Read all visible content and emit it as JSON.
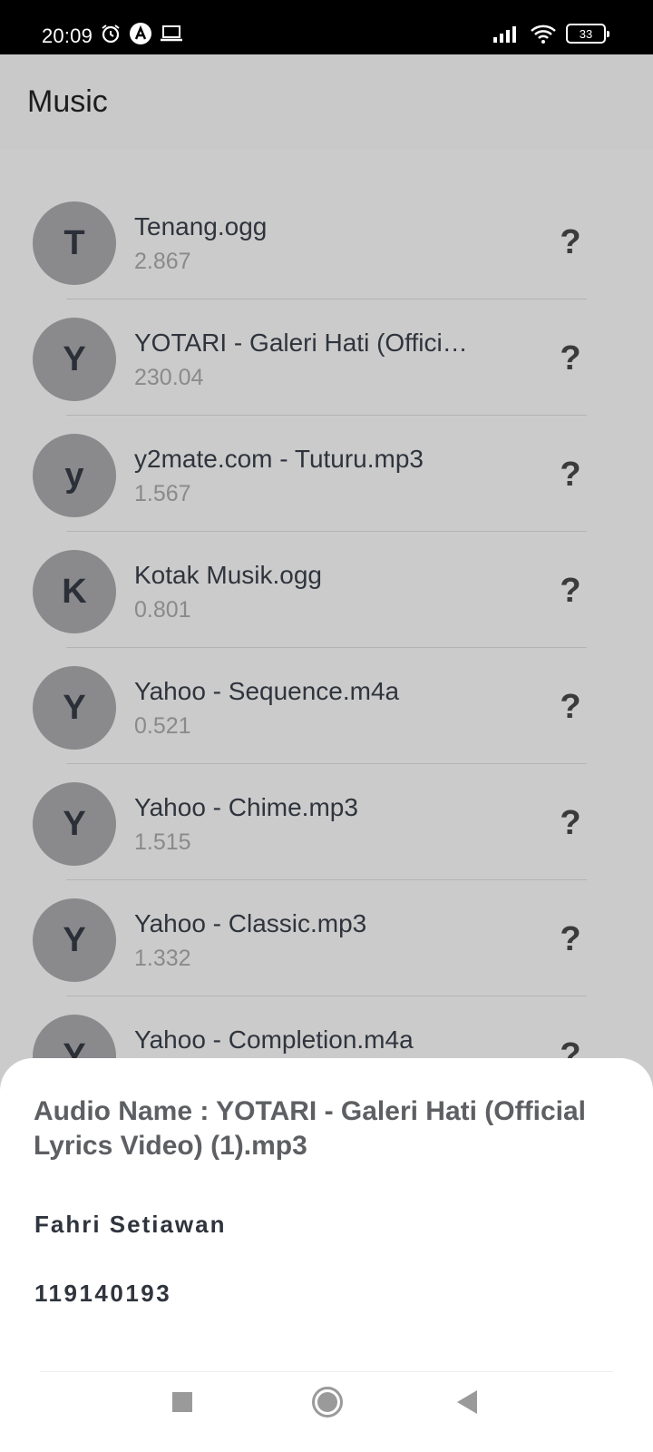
{
  "status_bar": {
    "time": "20:09",
    "battery": "33",
    "icons": [
      "alarm-icon",
      "app-a-icon",
      "laptop-icon",
      "signal-icon",
      "wifi-icon",
      "battery-icon"
    ]
  },
  "app": {
    "title": "Music"
  },
  "tracks": [
    {
      "avatar": "T",
      "title": "Tenang.ogg",
      "size": "2.867"
    },
    {
      "avatar": "Y",
      "title": "YOTARI - Galeri Hati (Offici…",
      "size": "230.04"
    },
    {
      "avatar": "y",
      "title": "y2mate.com - Tuturu.mp3",
      "size": "1.567"
    },
    {
      "avatar": "K",
      "title": "Kotak Musik.ogg",
      "size": "0.801"
    },
    {
      "avatar": "Y",
      "title": "Yahoo - Sequence.m4a",
      "size": "0.521"
    },
    {
      "avatar": "Y",
      "title": "Yahoo - Chime.mp3",
      "size": "1.515"
    },
    {
      "avatar": "Y",
      "title": "Yahoo - Classic.mp3",
      "size": "1.332"
    },
    {
      "avatar": "Y",
      "title": "Yahoo - Completion.m4a",
      "size": ""
    }
  ],
  "help_glyph": "?",
  "sheet": {
    "audio_label": "Audio Name : YOTARI - Galeri Hati (Official Lyrics Video) (1).mp3",
    "name": "Fahri Setiawan",
    "id": "119140193"
  },
  "nav": {
    "icons": [
      "recents-icon",
      "home-icon",
      "back-icon"
    ]
  }
}
